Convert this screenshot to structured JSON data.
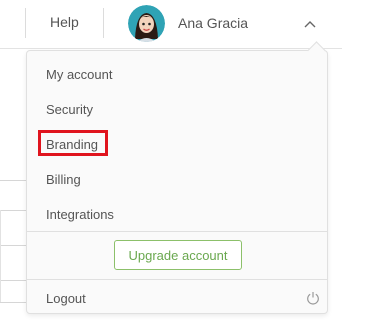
{
  "header": {
    "help_label": "Help",
    "user_name": "Ana Gracia"
  },
  "menu": {
    "items": [
      {
        "label": "My account"
      },
      {
        "label": "Security"
      },
      {
        "label": "Branding"
      },
      {
        "label": "Billing"
      },
      {
        "label": "Integrations"
      }
    ],
    "upgrade_label": "Upgrade account",
    "logout_label": "Logout"
  },
  "colors": {
    "highlight": "#e0141e",
    "upgrade_accent": "#6aa84f"
  }
}
